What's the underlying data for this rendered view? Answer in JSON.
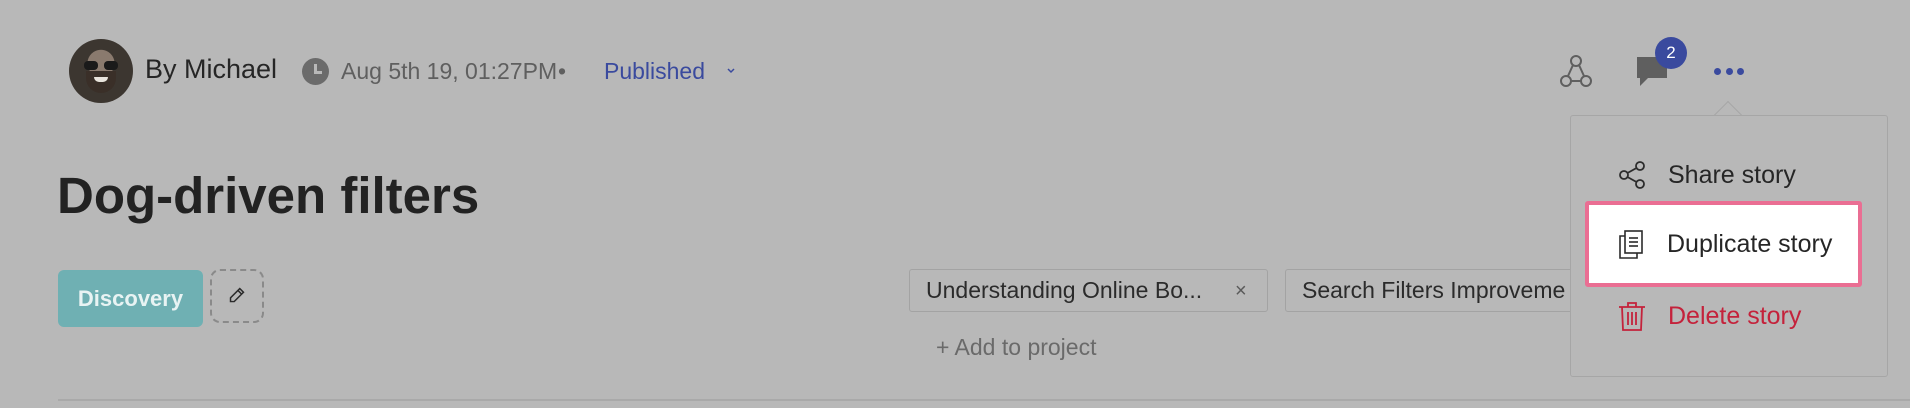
{
  "header": {
    "author": "By Michael",
    "timestamp": "Aug 5th 19, 01:27PM",
    "separator": "•",
    "status": "Published",
    "comment_count": "2"
  },
  "story": {
    "title": "Dog-driven filters",
    "stage": "Discovery"
  },
  "projects": {
    "chips": [
      {
        "label": "Understanding Online Bo...",
        "remove": "×"
      },
      {
        "label": "Search Filters Improveme"
      }
    ],
    "add_label": "+ Add to project"
  },
  "menu": {
    "items": [
      {
        "label": "Share story",
        "icon": "share-icon"
      },
      {
        "label": "Duplicate story",
        "icon": "duplicate-icon"
      },
      {
        "label": "Delete story",
        "icon": "trash-icon"
      }
    ]
  },
  "colors": {
    "accent": "#3a4a9e",
    "stage_tag": "#6fb0b3",
    "danger": "#c4223b",
    "highlight_border": "#ea6e93"
  }
}
